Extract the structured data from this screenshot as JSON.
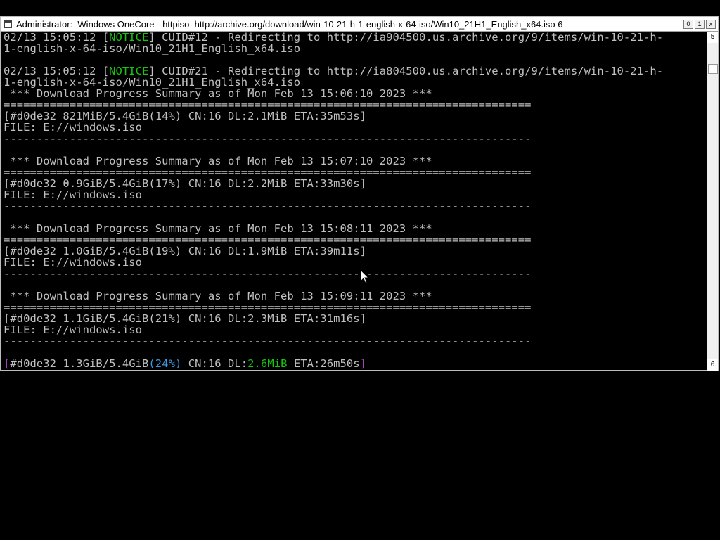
{
  "window": {
    "title": "Administrator:  Windows OneCore - httpiso  http://archive.org/download/win-10-21-h-1-english-x-64-iso/Win10_21H1_English_x64.iso 6",
    "buttons": {
      "minimize": "0",
      "maximize": "1",
      "close": "x"
    }
  },
  "scrollbar": {
    "up_label": "5",
    "down_label": "6"
  },
  "console": {
    "lines": [
      {
        "segs": [
          {
            "t": "02/13 15:05:12 [",
            "c": ""
          },
          {
            "t": "NOTICE",
            "c": "g"
          },
          {
            "t": "] CUID#12 - Redirecting to http://ia904500.us.archive.org/9/items/win-10-21-h-",
            "c": ""
          }
        ]
      },
      {
        "segs": [
          {
            "t": "1-english-x-64-iso/Win10_21H1_English_x64.iso",
            "c": ""
          }
        ]
      },
      {
        "segs": [
          {
            "t": "",
            "c": ""
          }
        ]
      },
      {
        "segs": [
          {
            "t": "02/13 15:05:12 [",
            "c": ""
          },
          {
            "t": "NOTICE",
            "c": "g"
          },
          {
            "t": "] CUID#21 - Redirecting to http://ia804500.us.archive.org/9/items/win-10-21-h-",
            "c": ""
          }
        ]
      },
      {
        "segs": [
          {
            "t": "1-english-x-64-iso/Win10_21H1_English_x64.iso",
            "c": ""
          }
        ]
      },
      {
        "segs": [
          {
            "t": " *** Download Progress Summary as of Mon Feb 13 15:06:10 2023 ***",
            "c": ""
          }
        ]
      },
      {
        "segs": [
          {
            "t": "================================================================================",
            "c": ""
          }
        ]
      },
      {
        "segs": [
          {
            "t": "[#d0de32 821MiB/5.4GiB(14%) CN:16 DL:2.1MiB ETA:35m53s]",
            "c": ""
          }
        ]
      },
      {
        "segs": [
          {
            "t": "FILE: E://windows.iso",
            "c": ""
          }
        ]
      },
      {
        "segs": [
          {
            "t": "--------------------------------------------------------------------------------",
            "c": ""
          }
        ]
      },
      {
        "segs": [
          {
            "t": "",
            "c": ""
          }
        ]
      },
      {
        "segs": [
          {
            "t": " *** Download Progress Summary as of Mon Feb 13 15:07:10 2023 ***",
            "c": ""
          }
        ]
      },
      {
        "segs": [
          {
            "t": "================================================================================",
            "c": ""
          }
        ]
      },
      {
        "segs": [
          {
            "t": "[#d0de32 0.9GiB/5.4GiB(17%) CN:16 DL:2.2MiB ETA:33m30s]",
            "c": ""
          }
        ]
      },
      {
        "segs": [
          {
            "t": "FILE: E://windows.iso",
            "c": ""
          }
        ]
      },
      {
        "segs": [
          {
            "t": "--------------------------------------------------------------------------------",
            "c": ""
          }
        ]
      },
      {
        "segs": [
          {
            "t": "",
            "c": ""
          }
        ]
      },
      {
        "segs": [
          {
            "t": " *** Download Progress Summary as of Mon Feb 13 15:08:11 2023 ***",
            "c": ""
          }
        ]
      },
      {
        "segs": [
          {
            "t": "================================================================================",
            "c": ""
          }
        ]
      },
      {
        "segs": [
          {
            "t": "[#d0de32 1.0GiB/5.4GiB(19%) CN:16 DL:1.9MiB ETA:39m11s]",
            "c": ""
          }
        ]
      },
      {
        "segs": [
          {
            "t": "FILE: E://windows.iso",
            "c": ""
          }
        ]
      },
      {
        "segs": [
          {
            "t": "--------------------------------------------------------------------------------",
            "c": ""
          }
        ]
      },
      {
        "segs": [
          {
            "t": "",
            "c": ""
          }
        ]
      },
      {
        "segs": [
          {
            "t": " *** Download Progress Summary as of Mon Feb 13 15:09:11 2023 ***",
            "c": ""
          }
        ]
      },
      {
        "segs": [
          {
            "t": "================================================================================",
            "c": ""
          }
        ]
      },
      {
        "segs": [
          {
            "t": "[#d0de32 1.1GiB/5.4GiB(21%) CN:16 DL:2.3MiB ETA:31m16s]",
            "c": ""
          }
        ]
      },
      {
        "segs": [
          {
            "t": "FILE: E://windows.iso",
            "c": ""
          }
        ]
      },
      {
        "segs": [
          {
            "t": "--------------------------------------------------------------------------------",
            "c": ""
          }
        ]
      },
      {
        "segs": [
          {
            "t": "",
            "c": ""
          }
        ]
      },
      {
        "segs": [
          {
            "t": "[",
            "c": "m"
          },
          {
            "t": "#d0de32 1.3GiB/5.4GiB",
            "c": ""
          },
          {
            "t": "(24%)",
            "c": "c"
          },
          {
            "t": " CN:16 DL:",
            "c": ""
          },
          {
            "t": "2.6MiB",
            "c": "g"
          },
          {
            "t": " ETA:26m50s",
            "c": ""
          },
          {
            "t": "]",
            "c": "m"
          }
        ]
      }
    ]
  },
  "colors": {
    "console_bg": "#000000",
    "console_fg": "#c0c0c0",
    "notice_green": "#16c60c",
    "bracket_magenta": "#b148c6",
    "percent_cyan": "#3a96dd",
    "titlebar_bg": "#ffffff"
  }
}
